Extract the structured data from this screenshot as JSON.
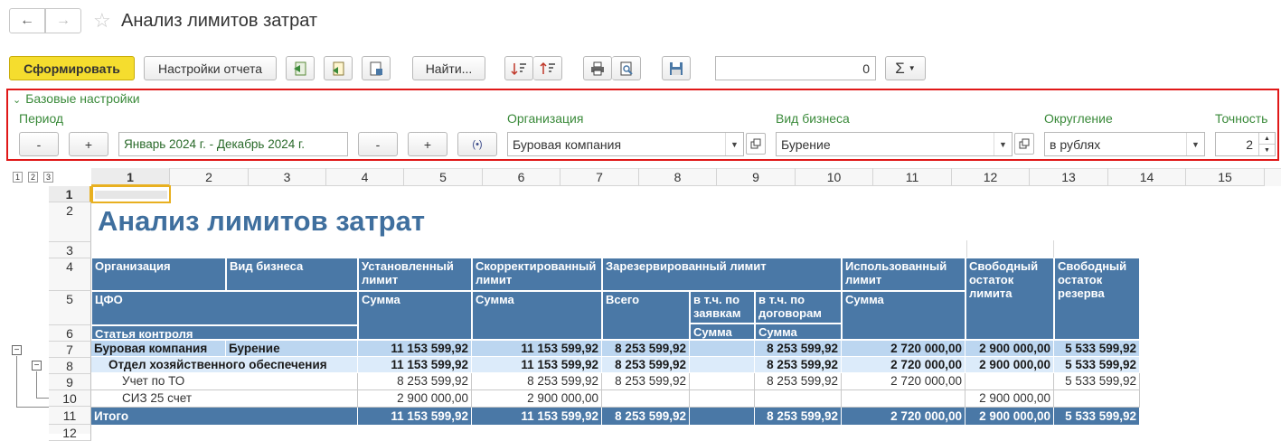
{
  "title": "Анализ лимитов затрат",
  "toolbar": {
    "generate": "Сформировать",
    "settings": "Настройки отчета",
    "find": "Найти...",
    "sum_value": "0",
    "sigma": "Σ"
  },
  "settings_panel": {
    "header": "Базовые настройки",
    "period_label": "Период",
    "period_value": "Январь 2024 г. - Декабрь 2024 г.",
    "minus": "-",
    "plus": "+",
    "org_label": "Организация",
    "org_value": "Буровая компания",
    "biz_label": "Вид бизнеса",
    "biz_value": "Бурение",
    "round_label": "Округление",
    "round_value": "в рублях",
    "precision_label": "Точность",
    "precision_value": "2"
  },
  "sheet": {
    "levels": [
      "1",
      "2",
      "3"
    ],
    "columns": [
      "1",
      "2",
      "3",
      "4",
      "5",
      "6",
      "7",
      "8",
      "9",
      "10",
      "11",
      "12",
      "13",
      "14",
      "15"
    ],
    "rows": [
      "1",
      "2",
      "3",
      "4",
      "5",
      "6",
      "7",
      "8",
      "9",
      "10",
      "11",
      "12"
    ],
    "report_title": "Анализ лимитов затрат",
    "headers": {
      "org": "Организация",
      "biz": "Вид бизнеса",
      "set_limit": "Установленный лимит",
      "adj_limit": "Скорректированный лимит",
      "reserved": "Зарезервированный лимит",
      "used": "Использованный лимит",
      "free_rest": "Свободный остаток лимита",
      "free_reserve": "Свободный остаток резерва",
      "cfo": "ЦФО",
      "sum": "Сумма",
      "total": "Всего",
      "by_requests": "в т.ч. по заявкам",
      "by_contracts": "в т.ч. по договорам",
      "article": "Статья контроля"
    },
    "data_rows": [
      {
        "label": "Буровая компания",
        "label2": "Бурение",
        "v": [
          "11 153 599,92",
          "11 153 599,92",
          "8 253 599,92",
          "",
          "8 253 599,92",
          "2 720 000,00",
          "2 900 000,00",
          "5 533 599,92"
        ]
      },
      {
        "label": "Отдел хозяйственного обеспечения",
        "label2": "",
        "v": [
          "11 153 599,92",
          "11 153 599,92",
          "8 253 599,92",
          "",
          "8 253 599,92",
          "2 720 000,00",
          "2 900 000,00",
          "5 533 599,92"
        ]
      },
      {
        "label": "Учет по ТО",
        "label2": "",
        "v": [
          "8 253 599,92",
          "8 253 599,92",
          "8 253 599,92",
          "",
          "8 253 599,92",
          "2 720 000,00",
          "",
          "5 533 599,92"
        ]
      },
      {
        "label": "СИЗ 25 счет",
        "label2": "",
        "v": [
          "2 900 000,00",
          "2 900 000,00",
          "",
          "",
          "",
          "",
          "2 900 000,00",
          ""
        ]
      },
      {
        "label": "Итого",
        "label2": "",
        "v": [
          "11 153 599,92",
          "11 153 599,92",
          "8 253 599,92",
          "",
          "8 253 599,92",
          "2 720 000,00",
          "2 900 000,00",
          "5 533 599,92"
        ]
      }
    ]
  }
}
